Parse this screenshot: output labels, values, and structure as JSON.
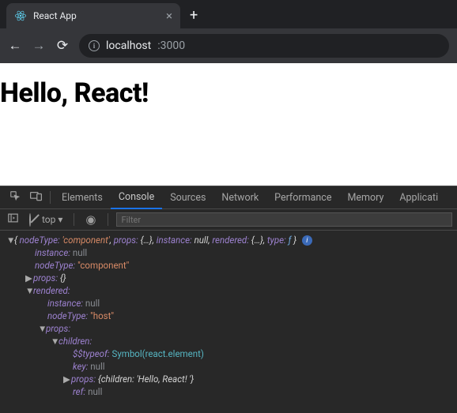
{
  "browser": {
    "tab_title": "React App",
    "url_host": "localhost",
    "url_port": ":3000"
  },
  "page": {
    "heading": "Hello, React!"
  },
  "devtools": {
    "tabs": [
      "Elements",
      "Console",
      "Sources",
      "Network",
      "Performance",
      "Memory",
      "Applicati"
    ],
    "active_tab": "Console",
    "context": "top",
    "filter_placeholder": "Filter",
    "console": {
      "preview_open": "{",
      "preview_k_nodeType": "nodeType:",
      "preview_v_nodeType": "'component'",
      "preview_k_props": "props:",
      "preview_v_props": "{…}",
      "preview_k_instance": "instance:",
      "preview_v_instance": "null",
      "preview_k_rendered": "rendered:",
      "preview_v_rendered": "{…}",
      "preview_k_type": "type:",
      "preview_v_type": "ƒ",
      "preview_close": "}",
      "k_instance": "instance:",
      "v_null": "null",
      "k_nodeType": "nodeType:",
      "v_component": "\"component\"",
      "k_props": "props:",
      "v_emptyobj": "{}",
      "k_rendered": "rendered:",
      "v_host": "\"host\"",
      "k_children": "children:",
      "k_typeof": "$$typeof:",
      "v_symbol": "Symbol(react.element)",
      "k_key": "key:",
      "v_propsobj": "{children: 'Hello, React! '}",
      "k_ref": "ref:"
    }
  }
}
